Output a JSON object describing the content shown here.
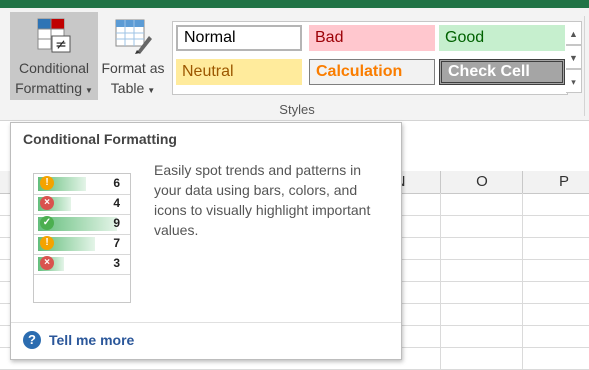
{
  "ribbon": {
    "conditional_formatting": {
      "line1": "Conditional",
      "line2": "Formatting",
      "icon": "conditional-formatting-icon"
    },
    "format_as_table": {
      "line1": "Format as",
      "line2": "Table",
      "icon": "format-as-table-icon"
    },
    "styles": {
      "cells": [
        {
          "label": "Normal"
        },
        {
          "label": "Bad"
        },
        {
          "label": "Good"
        },
        {
          "label": "Neutral"
        },
        {
          "label": "Calculation"
        },
        {
          "label": "Check Cell"
        }
      ],
      "group_label": "Styles"
    }
  },
  "sheet": {
    "columns": [
      "N",
      "O",
      "P"
    ]
  },
  "tooltip": {
    "title": "Conditional Formatting",
    "description": "Easily spot trends and patterns in your data using bars, colors, and icons to visually highlight important values.",
    "preview_rows": [
      {
        "value": "6",
        "icon": "warning-icon",
        "color": "#f4a300",
        "bar": 0.55
      },
      {
        "value": "4",
        "icon": "error-icon",
        "color": "#d9534f",
        "bar": 0.38
      },
      {
        "value": "9",
        "icon": "check-icon",
        "color": "#4caf50",
        "bar": 0.9
      },
      {
        "value": "7",
        "icon": "warning-icon",
        "color": "#f4a300",
        "bar": 0.65
      },
      {
        "value": "3",
        "icon": "error-icon",
        "color": "#d9534f",
        "bar": 0.3
      }
    ],
    "link_label": "Tell me more"
  },
  "colors": {
    "accent": "#217346",
    "link": "#2b579a",
    "bad_fill": "#ffc7ce",
    "good_fill": "#c6efce",
    "neutral_fill": "#ffeb9c",
    "calculation_text": "#fa7d00"
  }
}
